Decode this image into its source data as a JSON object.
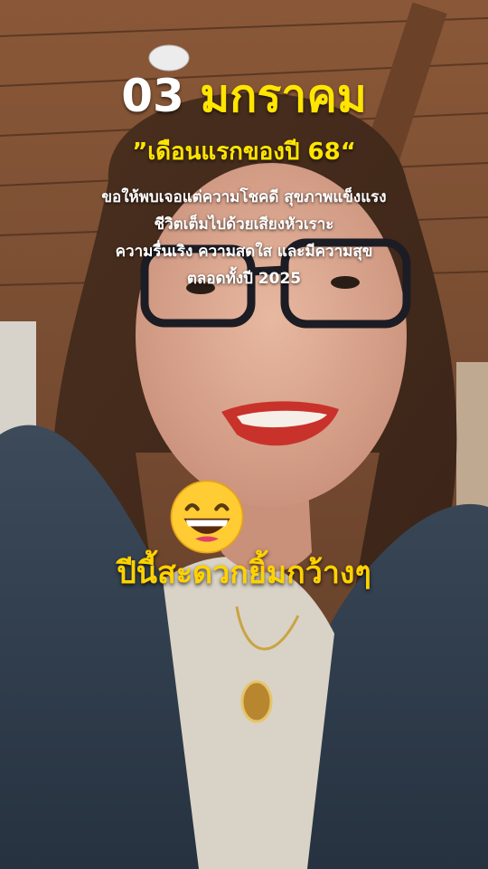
{
  "overlay": {
    "date_day": "03",
    "date_month": "มกราคม",
    "subtitle": "”เดือนแรกของปี 68“",
    "wish_lines": [
      "ขอให้พบเจอแต่ความโชคดี สุขภาพแข็งแรง",
      "ชีวิตเต็มไปด้วยเสียงหัวเราะ",
      "ความรื่นเริง ความสดใส และมีความสุข",
      "ตลอดทั้งปี 2025"
    ],
    "emoji": "grinning-face-emoji",
    "caption": "ปีนี้สะดวกยิ้มกว้างๆ"
  },
  "colors": {
    "accent_yellow": "#ffe500",
    "caption_orange_yellow": "#ffd200",
    "text_white": "#ffffff"
  }
}
